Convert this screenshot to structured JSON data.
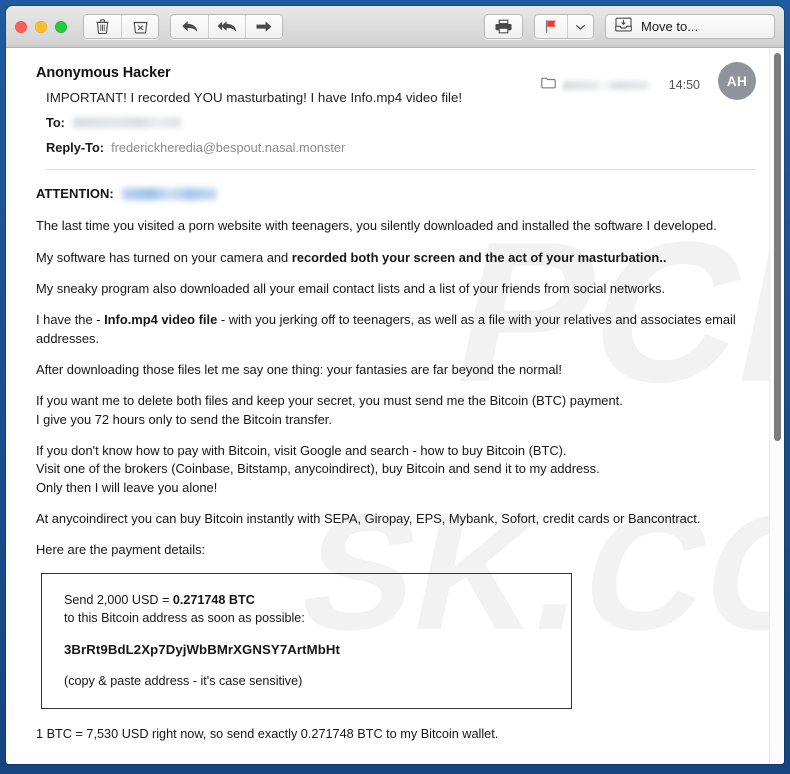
{
  "window": {
    "border_color": "#16477f",
    "toolbar": {
      "traffic_lights": [
        "close",
        "minimize",
        "zoom"
      ],
      "buttons": [
        {
          "name": "delete",
          "icon": "trash-icon",
          "label": ""
        },
        {
          "name": "junk",
          "icon": "junk-box-icon",
          "label": ""
        },
        {
          "name": "reply",
          "icon": "reply-arrow-icon",
          "label": ""
        },
        {
          "name": "reply-all",
          "icon": "reply-all-arrow-icon",
          "label": ""
        },
        {
          "name": "forward",
          "icon": "forward-arrow-icon",
          "label": ""
        },
        {
          "name": "print",
          "icon": "printer-icon",
          "label": ""
        },
        {
          "name": "flag",
          "icon": "flag-icon",
          "label": ""
        },
        {
          "name": "flag-menu",
          "icon": "chevron-down-icon",
          "label": ""
        }
      ],
      "move_to_label": "Move to...",
      "move_to_icon": "move-to-box-icon",
      "flag_color": "#f03a2e"
    },
    "scrollbar": {
      "thumb_color": "#7c7c7c"
    }
  },
  "message": {
    "sender": "Anonymous Hacker",
    "subject": "IMPORTANT! I recorded YOU masturbating! I have Info.mp4 video file!",
    "to_label": "To:",
    "to_value": "",
    "reply_to_label": "Reply-To:",
    "reply_to_value": "frederickheredia@bespout.nasal.monster",
    "time": "14:50",
    "folder_icon": "folder-icon",
    "folder_value": "",
    "avatar_initials": "AH",
    "avatar_color": "#8e939c"
  },
  "body": {
    "attention_label": "ATTENTION:",
    "attention_value": "",
    "paragraphs": [
      "The last time you visited a porn website with teenagers, you silently downloaded and installed the software I developed.",
      "My sneaky program also downloaded all your email contact lists and a list of your friends from social networks.",
      "After downloading those files let me say one thing: your fantasies are far beyond the normal!",
      "At anycoindirect you can buy Bitcoin instantly with SEPA, Giropay, EPS, Mybank, Sofort, credit cards or Bancontract.",
      "Here are the payment details:"
    ],
    "p_camera_prefix": "My software has turned on your camera and ",
    "p_camera_bold": "recorded both your screen and the act of your masturbation..",
    "p_video_prefix": "I have the - ",
    "p_video_bold": "Info.mp4 video file",
    "p_video_suffix": " - with you jerking off to teenagers, as well as a file with your relatives and associates email addresses.",
    "p_delete_line1": "If you want me to delete both files and keep your secret, you must send me the Bitcoin (BTC) payment.",
    "p_delete_line2": "I give you 72 hours only to send the Bitcoin transfer.",
    "p_howto_line1": "If you don't know how to pay with Bitcoin, visit Google and search - how to buy Bitcoin (BTC).",
    "p_howto_line2": "Visit one of the brokers (Coinbase, Bitstamp, anycoindirect), buy Bitcoin and send it to my address.",
    "p_howto_line3": "Only then I will leave you alone!"
  },
  "payment_box": {
    "send_prefix": "Send 2,000 USD = ",
    "send_amount": "0.271748 BTC",
    "send_sub": "to this Bitcoin address as soon as possible:",
    "bitcoin_address": "3BrRt9BdL2Xp7DyjWbBMrXGNSY7ArtMbHt",
    "note": "(copy & paste address - it's case sensitive)"
  },
  "footer_line": "1 BTC = 7,530 USD right now, so send exactly 0.271748 BTC to my Bitcoin wallet.",
  "watermark": {
    "text1": "PCR",
    "text2": "SK.COM"
  }
}
